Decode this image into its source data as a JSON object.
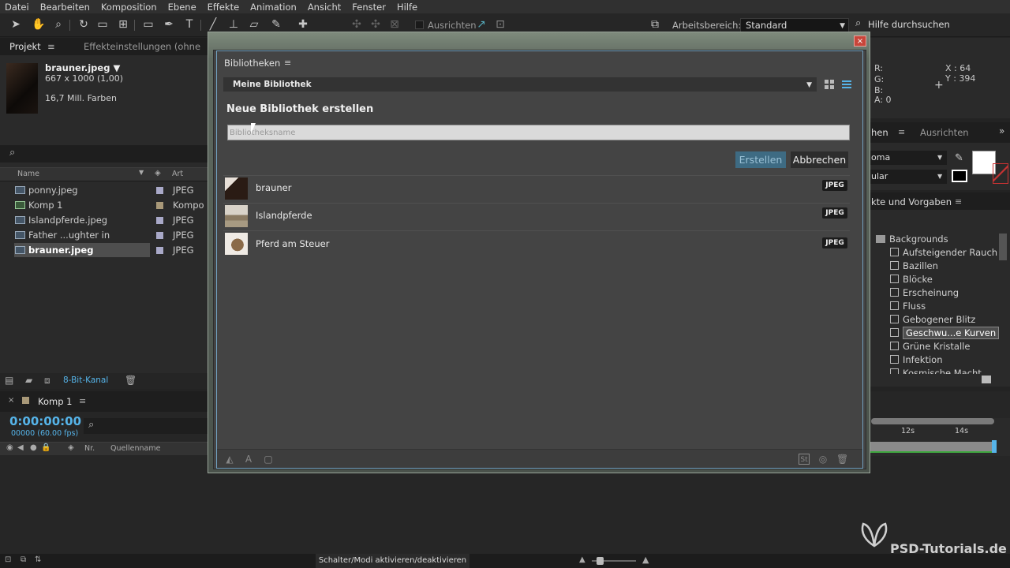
{
  "menubar": [
    "Datei",
    "Bearbeiten",
    "Komposition",
    "Ebene",
    "Effekte",
    "Animation",
    "Ansicht",
    "Fenster",
    "Hilfe"
  ],
  "toolbar": {
    "align_label": "Ausrichten",
    "workspace_label": "Arbeitsbereich:",
    "workspace_value": "Standard",
    "help_search": "Hilfe durchsuchen"
  },
  "project": {
    "tabs": [
      "Projekt",
      "Effekteinstellungen (ohne"
    ],
    "file_name": "brauner.jpeg ▼",
    "dimensions": "667 x 1000 (1,00)",
    "colors": "16,7 Mill. Farben",
    "columns": {
      "name": "Name",
      "type": "Art"
    },
    "files": [
      {
        "name": "ponny.jpeg",
        "type": "JPEG",
        "swatch": "#a9a9c8"
      },
      {
        "name": "Komp 1",
        "type": "Kompo",
        "swatch": "#a89878"
      },
      {
        "name": "Islandpferde.jpeg",
        "type": "JPEG",
        "swatch": "#a9a9c8"
      },
      {
        "name": "Father ...ughter in nature.jpeg",
        "type": "JPEG",
        "swatch": "#a9a9c8"
      },
      {
        "name": "brauner.jpeg",
        "type": "JPEG",
        "swatch": "#a9a9c8"
      }
    ],
    "bit_depth": "8-Bit-Kanal"
  },
  "timeline": {
    "comp_tab": "Komp 1",
    "timecode": "0:00:00:00",
    "fps": "00000 (60.00 fps)",
    "col_nr": "Nr.",
    "col_source": "Quellenname",
    "ticks": [
      "12s",
      "14s"
    ],
    "status": "Schalter/Modi aktivieren/deaktivieren"
  },
  "info": {
    "r": "R:",
    "g": "G:",
    "b": "B:",
    "a": "A:  0",
    "x": "X : 64",
    "y": "Y : 394"
  },
  "right_tabs": {
    "tab1": "hen",
    "tab2": "Ausrichten",
    "chroma": "oma",
    "regular": "ular"
  },
  "effects": {
    "header": "kte und Vorgaben",
    "folder": "Backgrounds",
    "items": [
      "Aufsteigender Rauch",
      "Bazillen",
      "Blöcke",
      "Erscheinung",
      "Fluss",
      "Gebogener Blitz",
      "Geschwu...e Kurven",
      "Grüne Kristalle",
      "Infektion",
      "Kosmische Macht"
    ]
  },
  "dialog": {
    "title": "Bibliotheken",
    "library": "Meine Bibliothek",
    "new_heading": "Neue Bibliothek erstellen",
    "input_placeholder": "Bibliotheksname",
    "create": "Erstellen",
    "cancel": "Abbrechen",
    "items": [
      {
        "name": "brauner",
        "badge": "JPEG"
      },
      {
        "name": "Islandpferde",
        "badge": "JPEG"
      },
      {
        "name": "Pferd am Steuer",
        "badge": "JPEG"
      }
    ]
  },
  "watermark": "PSD-Tutorials.de",
  "colors": {
    "accent": "#56b4e9",
    "create_button": "#3e6b83",
    "dialog_bg": "#444444"
  }
}
